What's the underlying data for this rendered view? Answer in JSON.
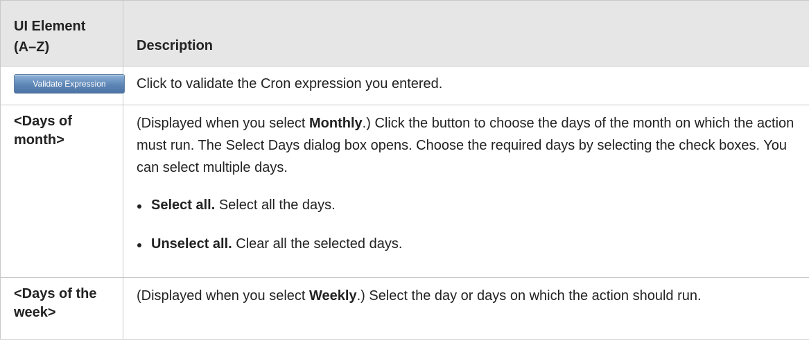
{
  "header": {
    "col1_line1": "UI Element",
    "col1_line2": "(A–Z)",
    "col2": "Description"
  },
  "rows": [
    {
      "button_label": "Validate Expression",
      "description": "Click to validate the Cron expression you entered."
    },
    {
      "element_line1": "<Days of",
      "element_line2": "month>",
      "desc_prefix": "(Displayed when you select ",
      "desc_keyword": "Monthly",
      "desc_suffix": ".) Click the button to choose the days of the month on which the action must run. The Select Days dialog box opens. Choose the required days by selecting the check boxes. You can select multiple days.",
      "options": [
        {
          "term": "Select all.",
          "text": " Select all the days."
        },
        {
          "term": "Unselect all.",
          "text": " Clear all the selected days."
        }
      ]
    },
    {
      "element_line1": "<Days of the",
      "element_line2": "week>",
      "desc_prefix": "(Displayed when you select ",
      "desc_keyword": "Weekly",
      "desc_suffix": ".) Select the day or days on which the action should run."
    }
  ],
  "colors": {
    "header_bg": "#e6e6e6",
    "border": "#c8c8c8",
    "button_bg": "#5e86b6"
  }
}
